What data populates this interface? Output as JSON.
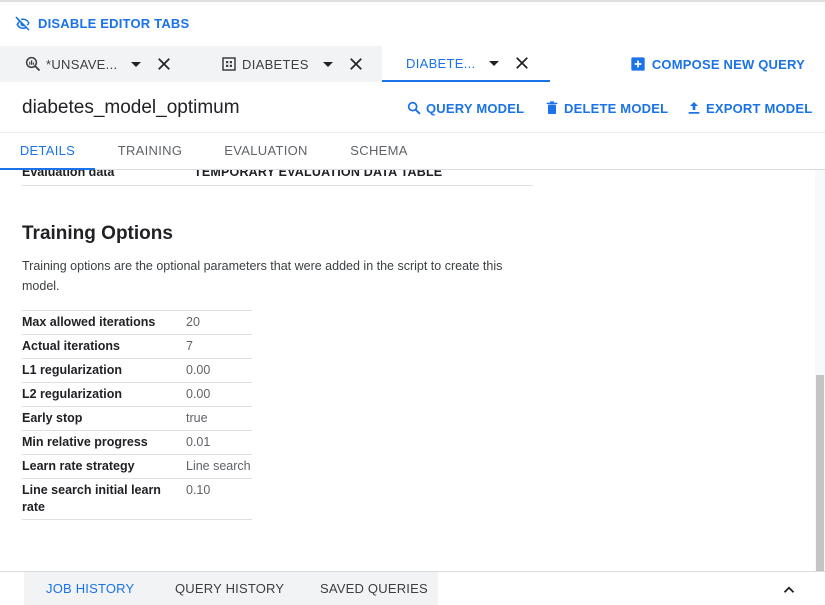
{
  "topbar": {
    "disable_tabs_label": "DISABLE EDITOR TABS"
  },
  "editor_tabs": [
    {
      "label": "*UNSAVE...",
      "icon": "query-icon"
    },
    {
      "label": "DIABETES",
      "icon": "table-grid-icon"
    },
    {
      "label": "DIABETE...",
      "active": true
    }
  ],
  "compose_label": "COMPOSE NEW QUERY",
  "model": {
    "title": "diabetes_model_optimum",
    "actions": {
      "query": "QUERY MODEL",
      "delete": "DELETE MODEL",
      "export": "EXPORT MODEL"
    }
  },
  "subtabs": {
    "details": "DETAILS",
    "training": "TRAINING",
    "evaluation": "EVALUATION",
    "schema": "SCHEMA"
  },
  "prev_row": {
    "key": "Evaluation data",
    "value": "TEMPORARY EVALUATION DATA TABLE"
  },
  "training_options": {
    "title": "Training Options",
    "description": "Training options are the optional parameters that were added in the script to create this model.",
    "rows": [
      {
        "key": "Max allowed iterations",
        "value": "20"
      },
      {
        "key": "Actual iterations",
        "value": "7"
      },
      {
        "key": "L1 regularization",
        "value": "0.00"
      },
      {
        "key": "L2 regularization",
        "value": "0.00"
      },
      {
        "key": "Early stop",
        "value": "true"
      },
      {
        "key": "Min relative progress",
        "value": "0.01"
      },
      {
        "key": "Learn rate strategy",
        "value": "Line search"
      },
      {
        "key": "Line search initial learn rate",
        "value": "0.10"
      }
    ]
  },
  "bottom_tabs": {
    "job_history": "JOB HISTORY",
    "query_history": "QUERY HISTORY",
    "saved_queries": "SAVED QUERIES"
  },
  "colors": {
    "accent": "#1a73e8",
    "text": "#202124",
    "muted": "#5f6368",
    "tab_bg": "#f1f3f4"
  }
}
